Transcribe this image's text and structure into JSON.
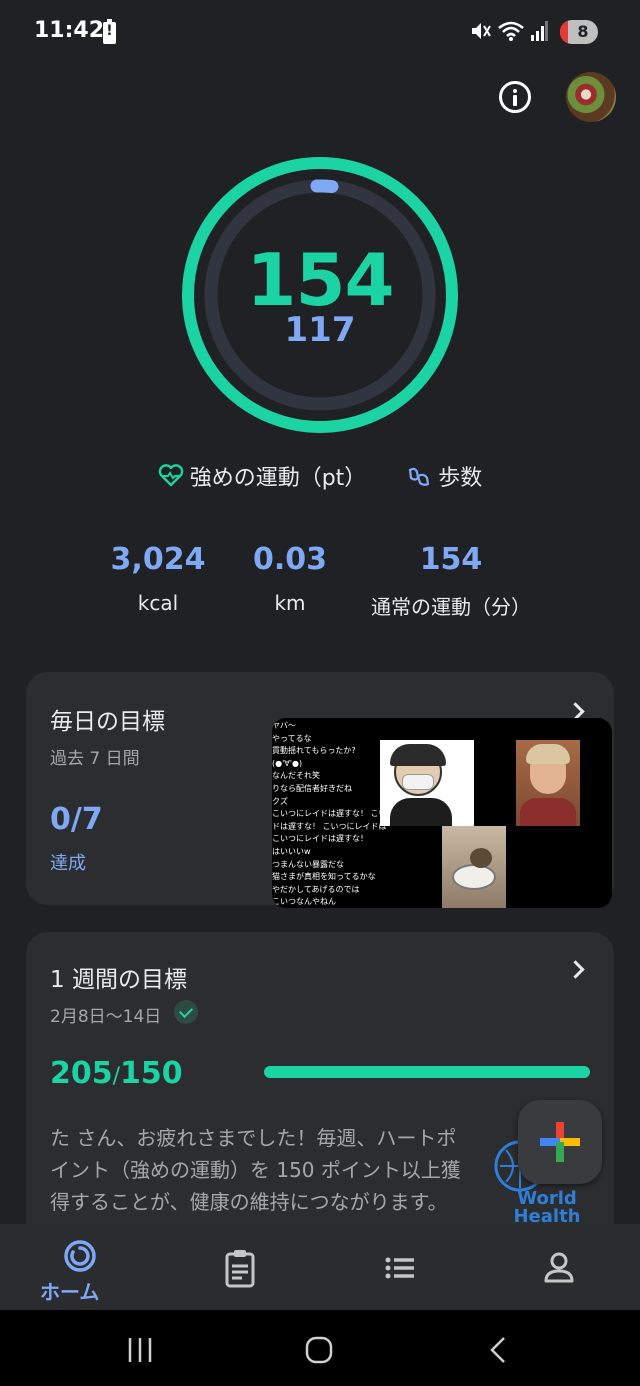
{
  "status_bar": {
    "time": "11:42",
    "alert_glyph": "!",
    "battery_level": "8",
    "icons": [
      "battery-alert-icon",
      "mute-icon",
      "wifi-icon",
      "signal-icon"
    ]
  },
  "ring": {
    "heart_points": "154",
    "steps": "117",
    "colors": {
      "outer": "#1bd3a3",
      "inner": "#7fa8f5",
      "track": "#30353f"
    }
  },
  "legend": {
    "heart_label": "強めの運動（pt）",
    "steps_label": "歩数"
  },
  "stats": [
    {
      "value": "3,024",
      "label": "kcal"
    },
    {
      "value": "0.03",
      "label": "km"
    },
    {
      "value": "154",
      "label": "通常の運動（分）"
    }
  ],
  "daily_goal": {
    "title": "毎日の目標",
    "subtitle": "過去 7 日間",
    "value": "0/7",
    "status": "達成"
  },
  "video_overlay": {
    "chat_lines": [
      "ヤバ～",
      "やってるな",
      "貫動揺れてもらったか?",
      "(●'∀'●)",
      "なんだそれ笑",
      "りなら配信者好きだね",
      "クズ",
      "こいつにレイドは遅すな！ こいつに",
      "ドは遅すな！ こいつにレイドは",
      "こいつにレイドは遅すな！",
      "はいいいw",
      "つまんない暴露だな",
      "猫さまが真相を知ってるかな",
      "やだかしてあげるのでは",
      "こいつなんやねん"
    ]
  },
  "weekly_goal": {
    "title": "1 週間の目標",
    "date_range": "2月8日〜14日",
    "current": "205",
    "separator": "/",
    "target": "150",
    "progress": 1.0,
    "message": "た さん、お疲れさまでした！毎週、ハートポイント（強めの運動）を 150 ポイント以上獲得することが、健康の維持につながります。",
    "who_text": "World Health Organization"
  },
  "bottom_nav": {
    "items": [
      {
        "icon": "home-icon",
        "label": "ホーム",
        "active": true
      },
      {
        "icon": "journal-icon"
      },
      {
        "icon": "browse-icon"
      },
      {
        "icon": "profile-icon"
      }
    ]
  },
  "system_nav": [
    "recents-icon",
    "home-circle-icon",
    "back-icon"
  ]
}
